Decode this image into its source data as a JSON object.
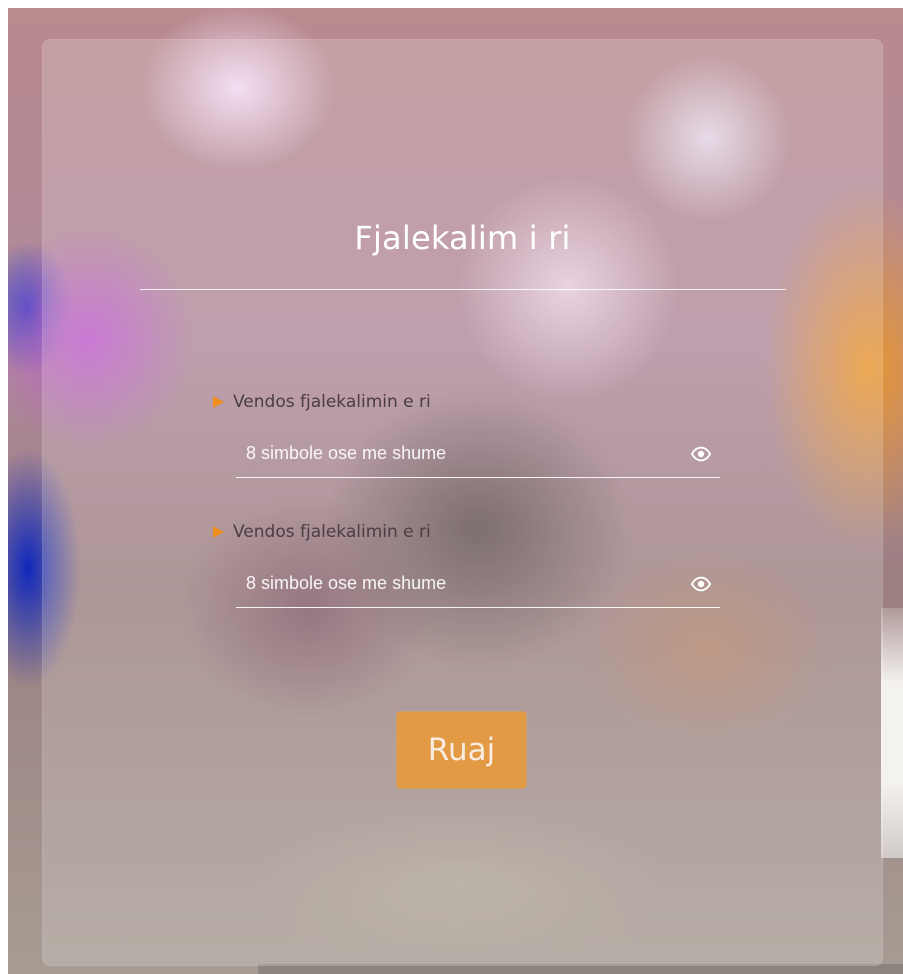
{
  "title": "Fjalekalim i ri",
  "fields": [
    {
      "label": "Vendos fjalekalimin e ri",
      "placeholder": "8 simbole ose me shume",
      "value": "",
      "icon": "eye-icon"
    },
    {
      "label": "Vendos fjalekalimin e ri",
      "placeholder": "8 simbole ose me shume",
      "value": "",
      "icon": "eye-icon"
    }
  ],
  "save_label": "Ruaj",
  "colors": {
    "accent": "#ee8e1e",
    "button": "#e29a45",
    "text_light": "#ffffff",
    "label_text": "#4a3d43"
  }
}
